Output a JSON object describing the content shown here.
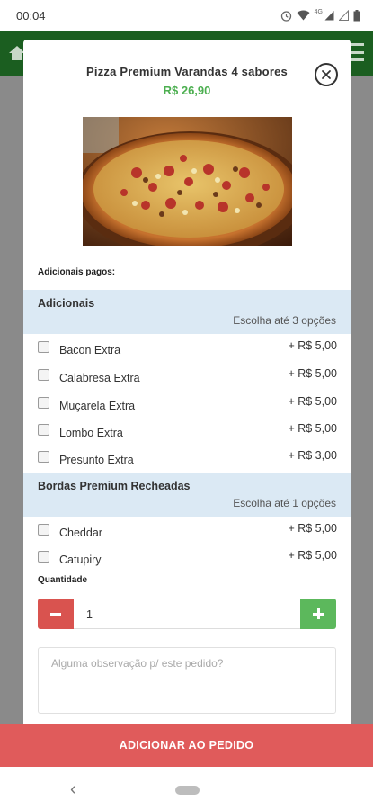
{
  "status_bar": {
    "time": "00:04",
    "network": "4G"
  },
  "product": {
    "title": "Pizza Premium Varandas 4 sabores",
    "price": "R$ 26,90",
    "price_color": "#4caf50"
  },
  "section_caption": "Adicionais pagos:",
  "groups": [
    {
      "title": "Adicionais",
      "limit": "Escolha até 3 opções",
      "options": [
        {
          "name": "Bacon Extra",
          "price": "+ R$ 5,00",
          "checked": false
        },
        {
          "name": "Calabresa Extra",
          "price": "+ R$ 5,00",
          "checked": false
        },
        {
          "name": "Muçarela Extra",
          "price": "+ R$ 5,00",
          "checked": false
        },
        {
          "name": "Lombo Extra",
          "price": "+ R$ 5,00",
          "checked": false
        },
        {
          "name": "Presunto Extra",
          "price": "+ R$ 3,00",
          "checked": false
        }
      ]
    },
    {
      "title": "Bordas Premium Recheadas",
      "limit": "Escolha até 1 opções",
      "options": [
        {
          "name": "Cheddar",
          "price": "+ R$ 5,00",
          "checked": false
        },
        {
          "name": "Catupiry",
          "price": "+ R$ 5,00",
          "checked": false
        }
      ]
    }
  ],
  "quantity": {
    "label": "Quantidade",
    "value": "1"
  },
  "observation": {
    "placeholder": "Alguma observação p/ este pedido?",
    "value": ""
  },
  "submit_label": "ADICIONAR AO PEDIDO",
  "colors": {
    "accent_red": "#e05b5b",
    "minus_red": "#d9534f",
    "plus_green": "#5cb85c",
    "group_header_bg": "#dbe9f4",
    "app_bar_green": "#1b5e20"
  },
  "icons": {
    "close": "close-circle-icon",
    "minus": "minus-icon",
    "plus": "plus-icon",
    "back": "back-chevron-icon"
  }
}
